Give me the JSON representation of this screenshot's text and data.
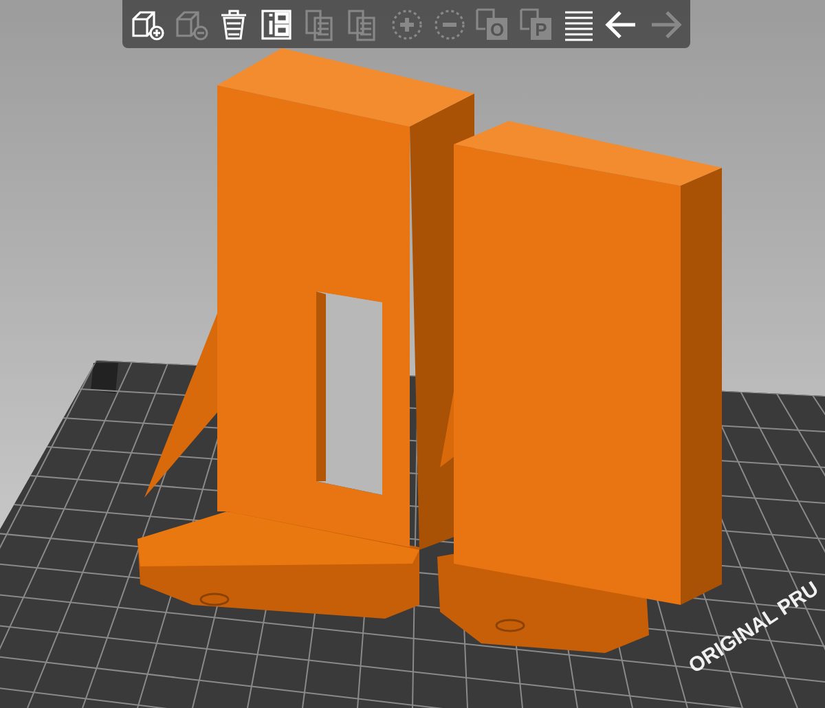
{
  "toolbar": {
    "tools": [
      {
        "kind": "add",
        "enabled": true
      },
      {
        "kind": "delete",
        "enabled": false
      },
      {
        "kind": "delete-all",
        "enabled": true
      },
      {
        "kind": "arrange",
        "enabled": true
      },
      {
        "kind": "copy",
        "enabled": false
      },
      {
        "kind": "paste",
        "enabled": false
      },
      {
        "kind": "instance-add",
        "enabled": false
      },
      {
        "kind": "instance-remove",
        "enabled": false
      },
      {
        "kind": "split-objects",
        "enabled": false,
        "letter": "O"
      },
      {
        "kind": "split-parts",
        "enabled": false,
        "letter": "P"
      },
      {
        "kind": "layers",
        "enabled": true
      },
      {
        "kind": "undo",
        "enabled": true
      },
      {
        "kind": "redo",
        "enabled": false
      }
    ]
  },
  "bed": {
    "label": "ORIGINAL PRU"
  }
}
